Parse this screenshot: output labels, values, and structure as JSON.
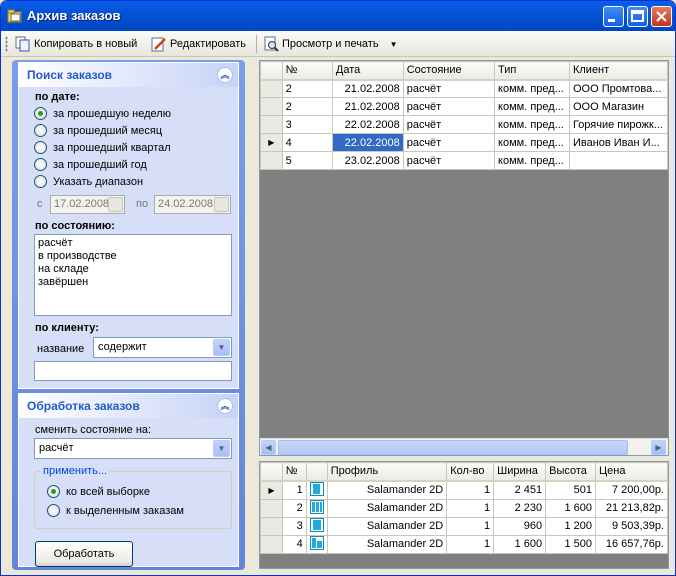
{
  "window": {
    "title": "Архив заказов"
  },
  "toolbar": {
    "copy_label": "Копировать в новый",
    "edit_label": "Редактировать",
    "print_label": "Просмотр и печать"
  },
  "search": {
    "header": "Поиск заказов",
    "by_date_label": "по дате:",
    "date_options": [
      {
        "label": "за прошедшую неделю",
        "checked": true
      },
      {
        "label": "за прошедший месяц",
        "checked": false
      },
      {
        "label": "за прошедший квартал",
        "checked": false
      },
      {
        "label": "за прошедший год",
        "checked": false
      },
      {
        "label": "Указать диапазон",
        "checked": false
      }
    ],
    "range_from_label": "с",
    "range_from_value": "17.02.2008",
    "range_to_label": "по",
    "range_to_value": "24.02.2008",
    "by_state_label": "по состоянию:",
    "states": [
      "расчёт",
      "в производстве",
      "на складе",
      "завёршен"
    ],
    "by_client_label": "по клиенту:",
    "name_label": "название",
    "name_mode": "содержит",
    "name_value": ""
  },
  "processing": {
    "header": "Обработка заказов",
    "change_state_label": "сменить состояние на:",
    "state_value": "расчёт",
    "apply_legend": "применить...",
    "apply_options": [
      {
        "label": "ко всей выборке",
        "checked": true
      },
      {
        "label": "к выделенным заказам",
        "checked": false
      }
    ],
    "process_button": "Обработать"
  },
  "orders": {
    "columns": [
      "№",
      "Дата",
      "Состояние",
      "Тип",
      "Клиент"
    ],
    "rows": [
      {
        "num": "2",
        "date": "21.02.2008",
        "state": "расчёт",
        "type": "комм. пред...",
        "client": "ООО Промтова..."
      },
      {
        "num": "2",
        "date": "21.02.2008",
        "state": "расчёт",
        "type": "комм. пред...",
        "client": "ООО Магазин"
      },
      {
        "num": "3",
        "date": "22.02.2008",
        "state": "расчёт",
        "type": "комм. пред...",
        "client": "Горячие пирожк..."
      },
      {
        "num": "4",
        "date": "22.02.2008",
        "state": "расчёт",
        "type": "комм. пред...",
        "client": "Иванов Иван И..."
      },
      {
        "num": "5",
        "date": "23.02.2008",
        "state": "расчёт",
        "type": "комм. пред...",
        "client": ""
      }
    ],
    "current_row": 3
  },
  "items": {
    "columns": [
      "№",
      "",
      "Профиль",
      "Кол-во",
      "Ширина",
      "Высота",
      "Цена"
    ],
    "rows": [
      {
        "num": "1",
        "profile": "Salamander 2D",
        "qty": "1",
        "width": "2 451",
        "height": "501",
        "price": "7 200,00р."
      },
      {
        "num": "2",
        "profile": "Salamander 2D",
        "qty": "1",
        "width": "2 230",
        "height": "1 600",
        "price": "21 213,82р."
      },
      {
        "num": "3",
        "profile": "Salamander 2D",
        "qty": "1",
        "width": "960",
        "height": "1 200",
        "price": "9 503,39р."
      },
      {
        "num": "4",
        "profile": "Salamander 2D",
        "qty": "1",
        "width": "1 600",
        "height": "1 500",
        "price": "16 657,76р."
      }
    ],
    "current_row": 0
  },
  "colors": {
    "title_bar": "#0353d8",
    "selection": "#316ac5",
    "taskpane": "#7a9ee6",
    "group_text": "#215dc6"
  }
}
